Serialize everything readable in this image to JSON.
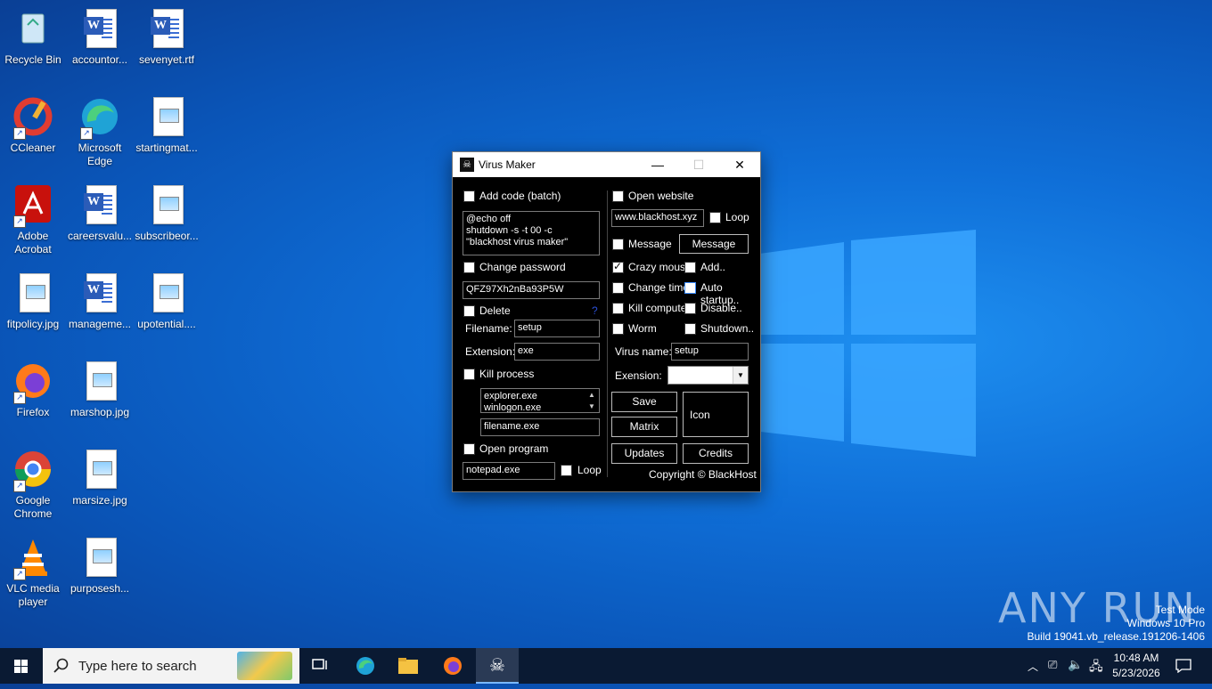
{
  "desktop": {
    "icons": [
      {
        "label": "Recycle Bin"
      },
      {
        "label": "accountor..."
      },
      {
        "label": "sevenyet.rtf"
      },
      {
        "label": "CCleaner"
      },
      {
        "label": "Microsoft Edge"
      },
      {
        "label": "startingmat..."
      },
      {
        "label": "Adobe Acrobat"
      },
      {
        "label": "careersvalu..."
      },
      {
        "label": "subscribeor..."
      },
      {
        "label": "fitpolicy.jpg"
      },
      {
        "label": "manageme..."
      },
      {
        "label": "upotential...."
      },
      {
        "label": "Firefox"
      },
      {
        "label": "marshop.jpg"
      },
      {
        "label": "Google Chrome"
      },
      {
        "label": "marsize.jpg"
      },
      {
        "label": "VLC media player"
      },
      {
        "label": "purposesh..."
      }
    ]
  },
  "window": {
    "title": "Virus Maker",
    "minimize": "—",
    "maximize": "☐",
    "close": "✕",
    "left": {
      "add_code_label": "Add code (batch)",
      "add_code_checked": false,
      "batch_code": "@echo off\nshutdown -s -t 00 -c \"blackhost virus maker\"",
      "change_password_label": "Change password",
      "password_value": "QFZ97Xh2nBa93P5W",
      "delete_label": "Delete",
      "help_mark": "?",
      "filename_label": "Filename:",
      "filename_value": "setup",
      "extension_label": "Extension:",
      "extension_value": "exe",
      "kill_process_label": "Kill process",
      "process_list": "explorer.exe\nwinlogon.exe",
      "process_filename": "filename.exe",
      "open_program_label": "Open program",
      "program_value": "notepad.exe",
      "loop_label": "Loop"
    },
    "right": {
      "open_website_label": "Open website",
      "website_value": "www.blackhost.xyz",
      "loop_label": "Loop",
      "message_cb_label": "Message",
      "message_btn_label": "Message",
      "crazy_mouse_label": "Crazy mouse",
      "crazy_mouse_checked": true,
      "add_label": "Add..",
      "change_time_label": "Change time",
      "auto_startup_label": "Auto startup..",
      "kill_computer_label": "Kill computer",
      "disable_label": "Disable..",
      "worm_label": "Worm",
      "shutdown_label": "Shutdown..",
      "virus_name_label": "Virus name:",
      "virus_name_value": "setup",
      "exension_label": "Exension:",
      "exension_value": "",
      "save_label": "Save",
      "matrix_label": "Matrix",
      "icon_label": "Icon",
      "updates_label": "Updates",
      "credits_label": "Credits",
      "copyright": "Copyright © BlackHost"
    }
  },
  "taskbar": {
    "search_placeholder": "Type here to search",
    "time": "10:48 AM",
    "date": "5/23/2026"
  },
  "watermark": {
    "line1": "Test Mode",
    "line2": "Windows 10 Pro",
    "line3": "Build 19041.vb_release.191206-1406",
    "brand": "ANY RUN"
  }
}
